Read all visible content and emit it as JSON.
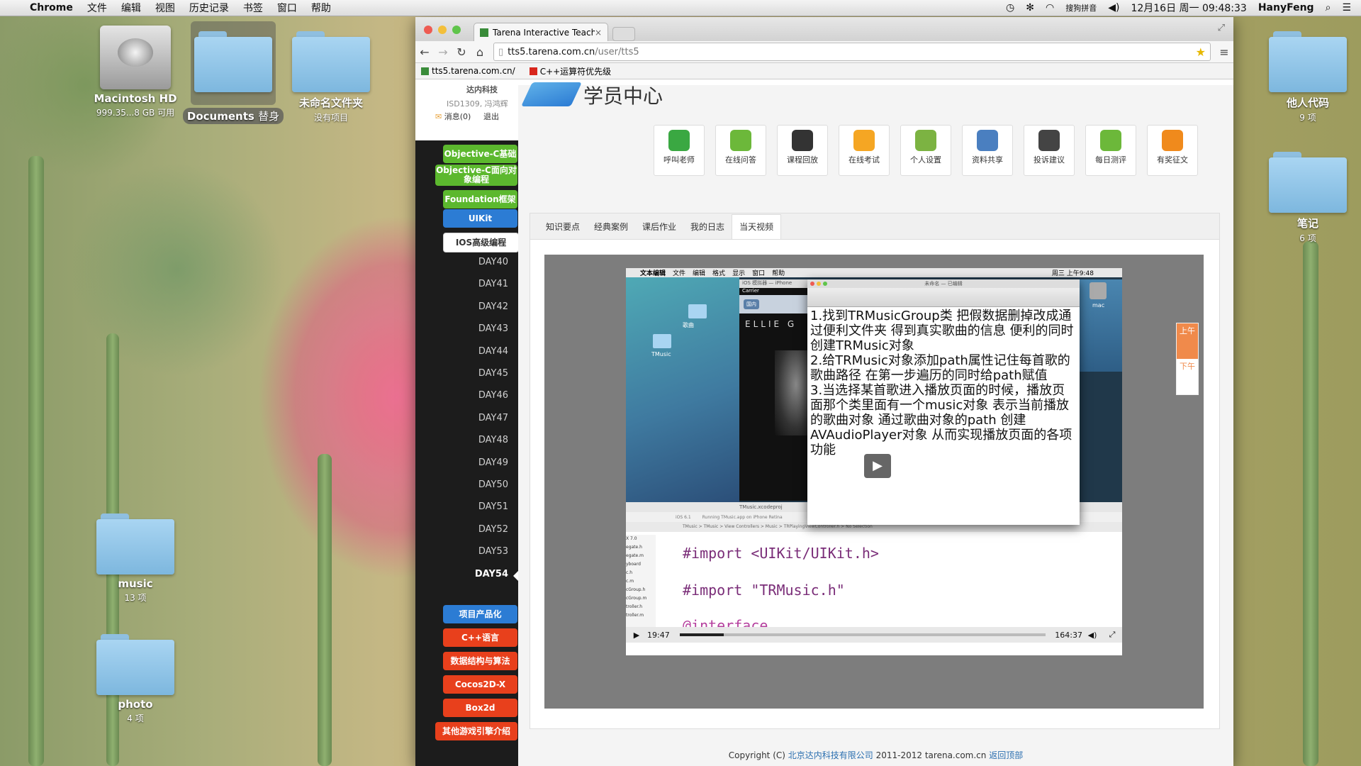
{
  "menubar": {
    "app_name": "Chrome",
    "items": [
      "文件",
      "编辑",
      "视图",
      "历史记录",
      "书签",
      "窗口",
      "帮助"
    ],
    "input_method": "搜狗拼音",
    "datetime": "12月16日 周一  09:48:33",
    "user": "HanyFeng"
  },
  "desktop": {
    "hdd": {
      "name": "Macintosh HD",
      "info": "999.35...8 GB 可用"
    },
    "documents": {
      "name": "Documents",
      "suffix": "替身"
    },
    "untitled": {
      "name": "未命名文件夹",
      "info": "没有项目"
    },
    "others_code": {
      "name": "他人代码",
      "info": "9 项"
    },
    "notes": {
      "name": "笔记",
      "info": "6 项"
    },
    "music": {
      "name": "music",
      "info": "13 项"
    },
    "photo": {
      "name": "photo",
      "info": "4 项"
    }
  },
  "browser": {
    "tab_title": "Tarena Interactive Teachin",
    "tab_close": "×",
    "url_host": "tts5.tarena.com.cn",
    "url_path": "/user/tts5",
    "bookmarks": [
      "tts5.tarena.com.cn/",
      "C++运算符优先级"
    ]
  },
  "site": {
    "org": "达内科技",
    "class_info": "ISD1309, 冯鸿辉",
    "messages": "消息(0)",
    "logout": "退出",
    "page_title": "学员中心",
    "nav_buttons": [
      {
        "label": "Objective-C基础",
        "color": "#5cb82e"
      },
      {
        "label": "Objective-C面向对象编程",
        "color": "#5cb82e"
      },
      {
        "label": "Foundation框架",
        "color": "#5cb82e"
      },
      {
        "label": "UIKit",
        "color": "#2c7cd4"
      },
      {
        "label": "IOS高级编程",
        "color": "#ffffff"
      }
    ],
    "days": [
      "DAY40",
      "DAY41",
      "DAY42",
      "DAY43",
      "DAY44",
      "DAY45",
      "DAY46",
      "DAY47",
      "DAY48",
      "DAY49",
      "DAY50",
      "DAY51",
      "DAY52",
      "DAY53",
      "DAY54"
    ],
    "active_day": "DAY54",
    "bottom_buttons": [
      {
        "label": "项目产品化",
        "color": "#2c7cd4"
      },
      {
        "label": "C++语言",
        "color": "#e8401c"
      },
      {
        "label": "数据结构与算法",
        "color": "#e8401c"
      },
      {
        "label": "Cocos2D-X",
        "color": "#e8401c"
      },
      {
        "label": "Box2d",
        "color": "#e8401c"
      },
      {
        "label": "其他游戏引擎介绍",
        "color": "#e8401c"
      }
    ],
    "tiles": [
      {
        "label": "呼叫老师",
        "color": "#3aa842"
      },
      {
        "label": "在线问答",
        "color": "#6cb83a"
      },
      {
        "label": "课程回放",
        "color": "#333333"
      },
      {
        "label": "在线考试",
        "color": "#f5a623"
      },
      {
        "label": "个人设置",
        "color": "#7cb342"
      },
      {
        "label": "资料共享",
        "color": "#4a7fc0"
      },
      {
        "label": "投诉建议",
        "color": "#444444"
      },
      {
        "label": "每日测评",
        "color": "#6cb83a"
      },
      {
        "label": "有奖征文",
        "color": "#f08a1c"
      }
    ],
    "panel_tabs": [
      "知识要点",
      "经典案例",
      "课后作业",
      "我的日志",
      "当天视频"
    ],
    "active_panel_tab": "当天视频",
    "side_note": {
      "am": "上午",
      "pm": "下午"
    },
    "footer": {
      "copyright": "Copyright (C)",
      "company": "北京达内科技有限公司",
      "years": "2011-2012 tarena.com.cn",
      "back_top": "返回顶部"
    }
  },
  "video": {
    "inner_menubar": {
      "app": "文本编辑",
      "items": [
        "文件",
        "编辑",
        "格式",
        "显示",
        "窗口",
        "帮助"
      ],
      "clock": "周三 上午9:48"
    },
    "doc_title": "未命名 — 已编辑",
    "simulator": {
      "title": "iOS 模拟器 — iPhone",
      "carrier": "Carrier",
      "back": "国内",
      "artist": "ELLIE G"
    },
    "desktop_labels": [
      "歌曲",
      "TMusic",
      "mac"
    ],
    "xcode": {
      "project": "TMusic.xcodeproj",
      "running": "Running TMusic.app on iPhone Retina",
      "sdk": "iOS 6.1",
      "breadcrumb": "TMusic > TMusic > View Controllers > Music > TRPlayingViewController.h > No Selection"
    },
    "note_lines": [
      "1.找到TRMusicGroup类 把假数据删掉改成通过便利文件夹 得到真实歌曲的信息 便利的同时 创建TRMusic对象",
      "2.给TRMusic对象添加path属性记住每首歌的歌曲路径 在第一步遍历的同时给path赋值",
      "3.当选择某首歌进入播放页面的时候，播放页面那个类里面有一个music对象 表示当前播放的歌曲对象 通过歌曲对象的path 创建AVAudioPlayer对象 从而实现播放页面的各项功能"
    ],
    "code_lines": [
      "#import <UIKit/UIKit.h>",
      "#import \"TRMusic.h\"",
      "@interface"
    ],
    "file_list": [
      "X 7.0",
      "egate.h",
      "egate.m",
      "yboard",
      "c.h",
      "c.m",
      "cGroup.h",
      "cGroup.m",
      "troller.h",
      "troller.m"
    ],
    "time_current": "19:47",
    "time_total": "164:37",
    "progress": 0.12
  }
}
